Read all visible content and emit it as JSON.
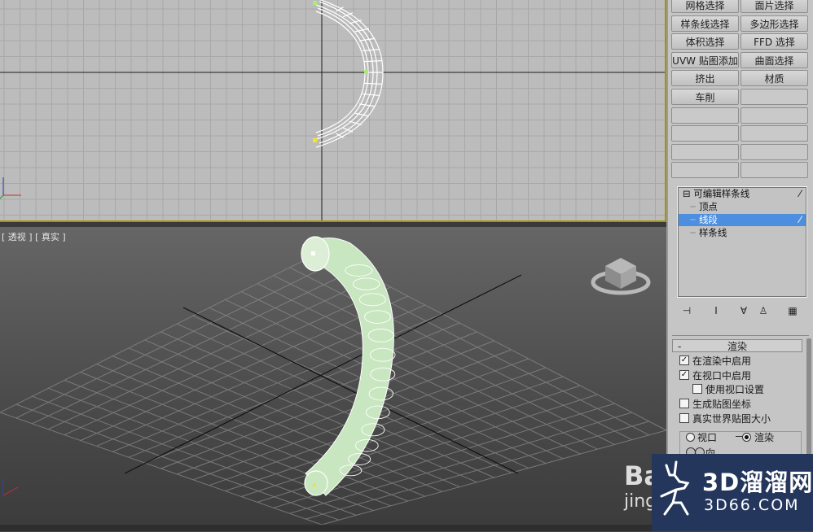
{
  "modifier_buttons": [
    [
      "网格选择",
      "面片选择"
    ],
    [
      "样条线选择",
      "多边形选择"
    ],
    [
      "体积选择",
      "FFD 选择"
    ],
    [
      "UVW 贴图添加",
      "曲面选择"
    ],
    [
      "挤出",
      "材质"
    ],
    [
      "车削",
      ""
    ],
    [
      "",
      ""
    ],
    [
      "",
      ""
    ],
    [
      "",
      ""
    ],
    [
      "",
      ""
    ]
  ],
  "viewports": {
    "perspective_label": "[ 透视 ] [ 真实 ]"
  },
  "modifier_stack": {
    "items": [
      {
        "label": "可编辑样条线",
        "expander": "⊟",
        "selected": false
      },
      {
        "label": "顶点",
        "selected": false
      },
      {
        "label": "线段",
        "selected": true
      },
      {
        "label": "样条线",
        "selected": false
      }
    ]
  },
  "render_rollout": {
    "collapse": "-",
    "title": "渲染",
    "options": [
      {
        "label": "在渲染中启用",
        "checked": true
      },
      {
        "label": "在视口中启用",
        "checked": true
      },
      {
        "label": "使用视口设置",
        "checked": false
      },
      {
        "label": "生成贴图坐标",
        "checked": false
      },
      {
        "label": "真实世界贴图大小",
        "checked": false
      }
    ],
    "radio_viewport": "视口",
    "radio_render": "渲染",
    "radial_partial": "向"
  },
  "watermark": {
    "brand": "3D溜溜网",
    "url": "3D66.COM",
    "baidu": "Ba",
    "baidu_sub": "jing"
  },
  "colors": {
    "selection": "#4d8fde",
    "active_border": "#a89400",
    "tube_fill": "#c8e6c0"
  }
}
